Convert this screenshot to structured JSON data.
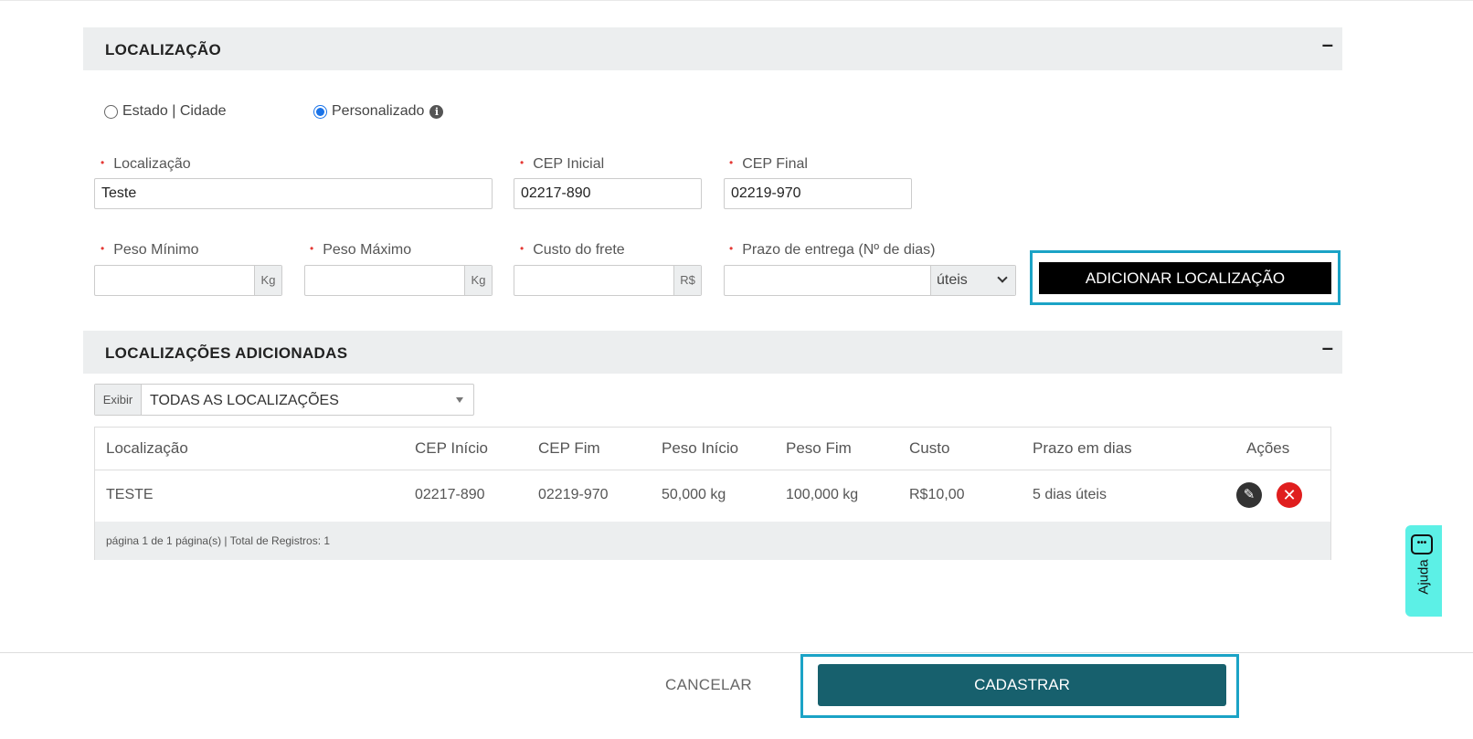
{
  "sections": {
    "location_title": "LOCALIZAÇÃO",
    "added_title": "LOCALIZAÇÕES ADICIONADAS",
    "collapse_symbol": "–"
  },
  "radio": {
    "option_state_city": "Estado | Cidade",
    "option_custom": "Personalizado",
    "selected": "Personalizado",
    "info_symbol": "i"
  },
  "form": {
    "location_label": "Localização",
    "location_value": "Teste",
    "cep_start_label": "CEP Inicial",
    "cep_start_value": "02217-890",
    "cep_end_label": "CEP Final",
    "cep_end_value": "02219-970",
    "weight_min_label": "Peso Mínimo",
    "weight_max_label": "Peso Máximo",
    "shipping_cost_label": "Custo do frete",
    "delivery_label": "Prazo de entrega (Nº de dias)",
    "unit_kg": "Kg",
    "unit_currency": "R$",
    "delivery_unit": "úteis",
    "required_mark": "•"
  },
  "add_button_label": "ADICIONAR LOCALIZAÇÃO",
  "filter": {
    "prefix": "Exibir",
    "value": "TODAS AS LOCALIZAÇÕES"
  },
  "table": {
    "headers": [
      "Localização",
      "CEP Início",
      "CEP Fim",
      "Peso Início",
      "Peso Fim",
      "Custo",
      "Prazo em dias",
      "Ações"
    ],
    "rows": [
      [
        "TESTE",
        "02217-890",
        "02219-970",
        "50,000 kg",
        "100,000 kg",
        "R$10,00",
        "5 dias úteis"
      ]
    ],
    "footer": "página 1 de 1 página(s) | Total de Registros: 1"
  },
  "help": {
    "label": "Ajuda"
  },
  "footer": {
    "cancel_label": "CANCELAR",
    "submit_label": "CADASTRAR"
  },
  "colors": {
    "accent_teal": "#17606d",
    "highlight": "#1ba3c6",
    "help_tab": "#5cf0e6",
    "delete_red": "#e01e1e"
  }
}
